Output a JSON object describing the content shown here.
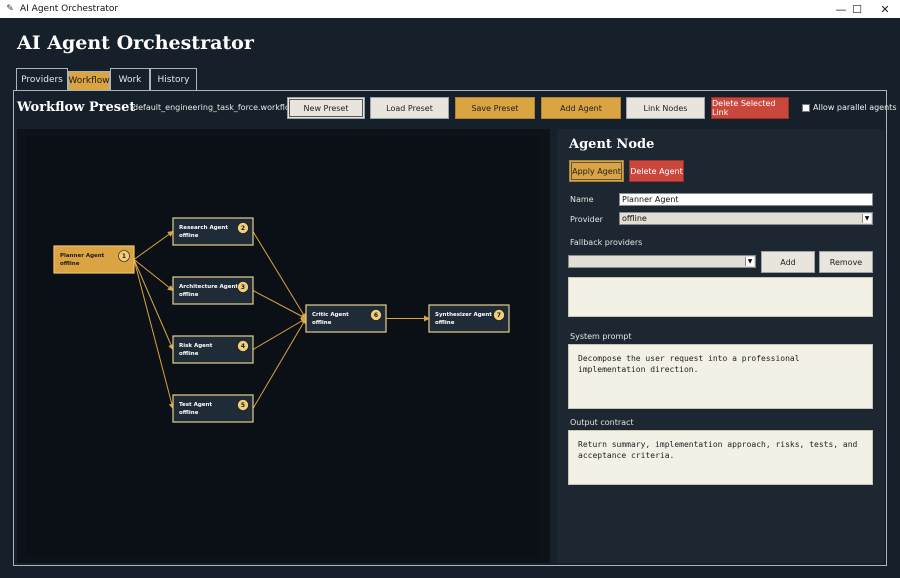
{
  "window": {
    "title": "AI Agent Orchestrator",
    "controls": {
      "minimize": "—",
      "maximize": "☐",
      "close": "✕"
    }
  },
  "app": {
    "title": "AI Agent Orchestrator"
  },
  "tabs": [
    {
      "label": "Providers"
    },
    {
      "label": "Workflow",
      "active": true
    },
    {
      "label": "Work"
    },
    {
      "label": "History"
    }
  ],
  "toolbar": {
    "title": "Workflow Preset",
    "preset_file": "default_engineering_task_force.workflow.json",
    "new_preset": "New Preset",
    "load_preset": "Load Preset",
    "save_preset": "Save Preset",
    "add_agent": "Add Agent",
    "link_nodes": "Link Nodes",
    "delete_link": "Delete Selected Link",
    "allow_parallel": "Allow parallel agents"
  },
  "graph": {
    "nodes": [
      {
        "id": 1,
        "name": "Planner Agent",
        "provider": "offline",
        "selected": true
      },
      {
        "id": 2,
        "name": "Research Agent",
        "provider": "offline"
      },
      {
        "id": 3,
        "name": "Architecture Agent",
        "provider": "offline"
      },
      {
        "id": 4,
        "name": "Risk Agent",
        "provider": "offline"
      },
      {
        "id": 5,
        "name": "Test Agent",
        "provider": "offline"
      },
      {
        "id": 6,
        "name": "Critic Agent",
        "provider": "offline"
      },
      {
        "id": 7,
        "name": "Synthesizer Agent",
        "provider": "offline"
      }
    ],
    "edges": [
      [
        1,
        2
      ],
      [
        1,
        3
      ],
      [
        1,
        4
      ],
      [
        1,
        5
      ],
      [
        2,
        6
      ],
      [
        3,
        6
      ],
      [
        4,
        6
      ],
      [
        5,
        6
      ],
      [
        6,
        7
      ]
    ],
    "colors": {
      "accent": "#d9a441",
      "node_fill": "#1f2b36",
      "edge": "#d9a441"
    }
  },
  "agent_node": {
    "title": "Agent Node",
    "apply": "Apply Agent",
    "delete": "Delete Agent",
    "name_label": "Name",
    "name_value": "Planner Agent",
    "provider_label": "Provider",
    "provider_value": "offline",
    "fallback_label": "Fallback providers",
    "fallback_value": "",
    "add": "Add",
    "remove": "Remove",
    "system_prompt_label": "System prompt",
    "system_prompt": "Decompose the user request into a professional\nimplementation direction.",
    "output_contract_label": "Output contract",
    "output_contract": "Return summary, implementation approach, risks, tests, and\nacceptance criteria."
  }
}
